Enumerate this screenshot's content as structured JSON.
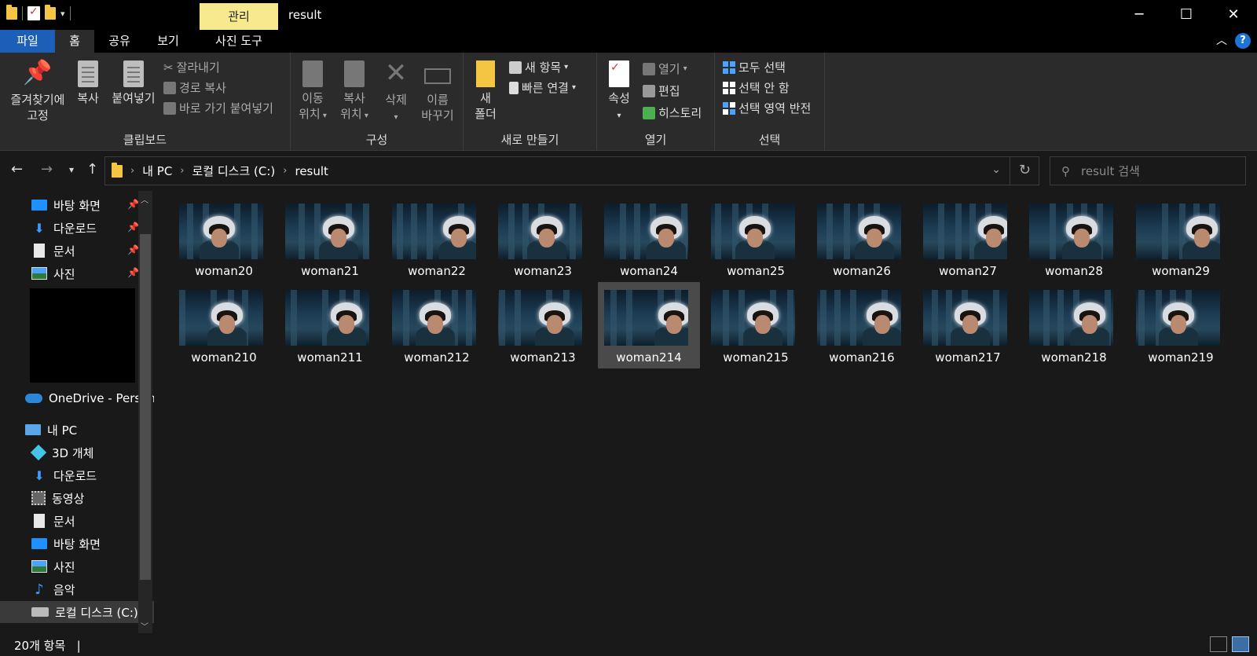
{
  "titlebar": {
    "context_tab": "관리",
    "title": "result",
    "minimize": "─",
    "maximize": "☐",
    "close": "✕"
  },
  "tabs": [
    {
      "label": "파일"
    },
    {
      "label": "홈"
    },
    {
      "label": "공유"
    },
    {
      "label": "보기"
    },
    {
      "label": "사진 도구"
    }
  ],
  "ribbon": {
    "clipboard": {
      "label": "클립보드",
      "pin_line1": "즐겨찾기에",
      "pin_line2": "고정",
      "copy": "복사",
      "paste": "붙여넣기",
      "cut": "잘라내기",
      "copy_path": "경로 복사",
      "paste_shortcut": "바로 가기 붙여넣기"
    },
    "organize": {
      "label": "구성",
      "move_line1": "이동",
      "move_line2": "위치",
      "copy_line1": "복사",
      "copy_line2": "위치",
      "delete": "삭제",
      "rename_line1": "이름",
      "rename_line2": "바꾸기"
    },
    "new": {
      "label": "새로 만들기",
      "folder_line1": "새",
      "folder_line2": "폴더",
      "new_item": "새 항목",
      "easy_access": "빠른 연결"
    },
    "open": {
      "label": "열기",
      "properties": "속성",
      "open": "열기",
      "edit": "편집",
      "history": "히스토리"
    },
    "select": {
      "label": "선택",
      "select_all": "모두 선택",
      "select_none": "선택 안 함",
      "invert": "선택 영역 반전"
    }
  },
  "address": {
    "crumbs": [
      "내 PC",
      "로컬 디스크 (C:)",
      "result"
    ],
    "search_placeholder": "result 검색"
  },
  "sidebar": {
    "quick_access": [
      {
        "label": "바탕 화면",
        "icon": "desktop-icon"
      },
      {
        "label": "다운로드",
        "icon": "download-icon"
      },
      {
        "label": "문서",
        "icon": "document-icon"
      },
      {
        "label": "사진",
        "icon": "pictures-icon"
      }
    ],
    "onedrive": "OneDrive - Person",
    "this_pc": "내 PC",
    "pc_items": [
      {
        "label": "3D 개체",
        "icon": "3d-objects-icon"
      },
      {
        "label": "다운로드",
        "icon": "download-icon"
      },
      {
        "label": "동영상",
        "icon": "videos-icon"
      },
      {
        "label": "문서",
        "icon": "document-icon"
      },
      {
        "label": "바탕 화면",
        "icon": "desktop-icon"
      },
      {
        "label": "사진",
        "icon": "pictures-icon"
      },
      {
        "label": "음악",
        "icon": "music-icon"
      },
      {
        "label": "로컬 디스크 (C:)",
        "icon": "disk-icon"
      }
    ]
  },
  "files": [
    "woman20",
    "woman21",
    "woman22",
    "woman23",
    "woman24",
    "woman25",
    "woman26",
    "woman27",
    "woman28",
    "woman29",
    "woman210",
    "woman211",
    "woman212",
    "woman213",
    "woman214",
    "woman215",
    "woman216",
    "woman217",
    "woman218",
    "woman219"
  ],
  "selected_file": "woman214",
  "status": {
    "count": "20개 항목",
    "separator": "|"
  },
  "colors": {
    "file_tab": "#1c5fb8",
    "context_tab": "#f7e98e",
    "background": "#191919",
    "ribbon": "#2b2b2b"
  }
}
